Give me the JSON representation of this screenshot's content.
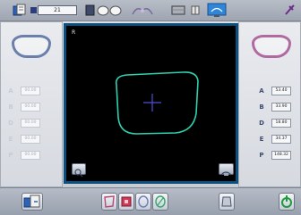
{
  "topbar": {
    "job_number": "21",
    "icons": [
      "operator-icon",
      "job-indicator-icon",
      "lens-shape-icon",
      "bevel-mode-icon",
      "frame-mode-icon",
      "measure-mode-icon",
      "monitor-icon",
      "settings-tool-icon"
    ]
  },
  "left_panel": {
    "rows": [
      {
        "key": "A",
        "value": "00.00"
      },
      {
        "key": "B",
        "value": "00.00"
      },
      {
        "key": "D",
        "value": "00.00"
      },
      {
        "key": "E",
        "value": "00.00"
      },
      {
        "key": "P",
        "value": "00.00"
      }
    ]
  },
  "right_panel": {
    "rows": [
      {
        "key": "A",
        "value": "53.40"
      },
      {
        "key": "B",
        "value": "33.90"
      },
      {
        "key": "D",
        "value": "18.80"
      },
      {
        "key": "E",
        "value": "34.37"
      },
      {
        "key": "P",
        "value": "148.32"
      }
    ]
  },
  "trace": {
    "corner_label": "R"
  },
  "colors": {
    "trace_outline": "#2fd0b0",
    "center_cross": "#4d4fd6",
    "frame_border": "#0a4f7d"
  }
}
